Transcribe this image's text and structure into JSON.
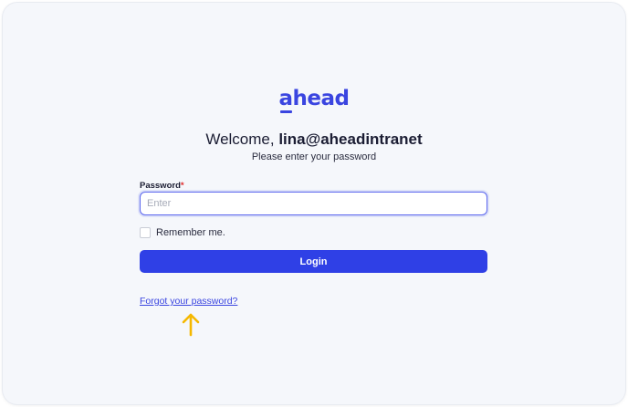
{
  "brand": {
    "logo_first": "a",
    "logo_rest": "head",
    "color": "#3a45e0"
  },
  "login": {
    "welcome_prefix": "Welcome, ",
    "email": "lina@aheadintranet",
    "subtitle": "Please enter your password",
    "password_label": "Password",
    "required_mark": "*",
    "password_placeholder": "Enter",
    "password_value": "",
    "remember_label": "Remember me.",
    "remember_checked": false,
    "login_button": "Login",
    "forgot_link": "Forgot your password?"
  },
  "annotation": {
    "arrow_icon": "arrow-up-icon",
    "arrow_color": "#f5b800"
  }
}
